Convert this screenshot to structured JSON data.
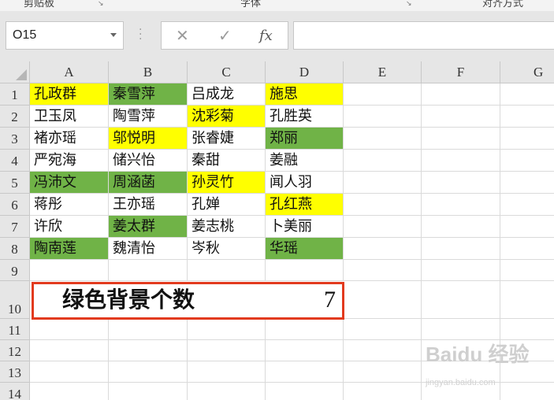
{
  "ribbon": {
    "groups": [
      {
        "label": "剪贴板"
      },
      {
        "label": "字体"
      },
      {
        "label": "对齐方式"
      }
    ]
  },
  "formula_bar": {
    "name_box": "O15",
    "cancel_symbol": "✕",
    "enter_symbol": "✓",
    "fx_symbol": "fx",
    "formula_value": ""
  },
  "sheet": {
    "columns": [
      "A",
      "B",
      "C",
      "D",
      "E",
      "F",
      "G"
    ],
    "rows": [
      "1",
      "2",
      "3",
      "4",
      "5",
      "6",
      "7",
      "8",
      "9",
      "10",
      "11",
      "12",
      "13",
      "14"
    ],
    "cells": [
      [
        {
          "t": "孔政群",
          "f": "yellow"
        },
        {
          "t": "秦雪萍",
          "f": "green"
        },
        {
          "t": "吕成龙",
          "f": ""
        },
        {
          "t": "施思",
          "f": "yellow"
        }
      ],
      [
        {
          "t": "卫玉凤",
          "f": ""
        },
        {
          "t": "陶雪萍",
          "f": ""
        },
        {
          "t": "沈彩菊",
          "f": "yellow"
        },
        {
          "t": "孔胜英",
          "f": ""
        }
      ],
      [
        {
          "t": "褚亦瑶",
          "f": ""
        },
        {
          "t": "邬悦明",
          "f": "yellow"
        },
        {
          "t": "张睿婕",
          "f": ""
        },
        {
          "t": "郑丽",
          "f": "green"
        }
      ],
      [
        {
          "t": "严宛海",
          "f": ""
        },
        {
          "t": "储兴怡",
          "f": ""
        },
        {
          "t": "秦甜",
          "f": ""
        },
        {
          "t": "姜融",
          "f": ""
        }
      ],
      [
        {
          "t": "冯沛文",
          "f": "green"
        },
        {
          "t": "周涵菡",
          "f": "green"
        },
        {
          "t": "孙灵竹",
          "f": "yellow"
        },
        {
          "t": "闻人羽",
          "f": ""
        }
      ],
      [
        {
          "t": "蒋彤",
          "f": ""
        },
        {
          "t": "王亦瑶",
          "f": ""
        },
        {
          "t": "孔婵",
          "f": ""
        },
        {
          "t": "孔红燕",
          "f": "yellow"
        }
      ],
      [
        {
          "t": "许欣",
          "f": ""
        },
        {
          "t": "姜太群",
          "f": "green"
        },
        {
          "t": "姜志桃",
          "f": ""
        },
        {
          "t": "卜美丽",
          "f": ""
        }
      ],
      [
        {
          "t": "陶南莲",
          "f": "green"
        },
        {
          "t": "魏清怡",
          "f": ""
        },
        {
          "t": "岑秋",
          "f": ""
        },
        {
          "t": "华瑶",
          "f": "green"
        }
      ]
    ],
    "summary_label": "绿色背景个数",
    "summary_value": "7"
  },
  "watermark": {
    "brand": "Baidu 经验",
    "url": "jingyan.baidu.com"
  },
  "colors": {
    "green_fill": "#70b347",
    "yellow_fill": "#ffff00",
    "highlight_border": "#e23a1e"
  }
}
